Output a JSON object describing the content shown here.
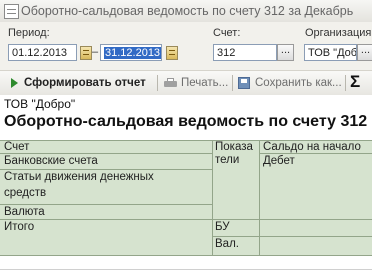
{
  "window": {
    "title": "Оборотно-сальдовая ведомость по счету 312 за Декабрь"
  },
  "params": {
    "period_label": "Период:",
    "date_from": "01.12.2013",
    "dash": "–",
    "date_to": "31.12.2013",
    "account_label": "Счет:",
    "account_value": "312",
    "dots": "...",
    "org_label": "Организация",
    "org_value": "ТОВ \"Добро\""
  },
  "toolbar": {
    "generate": "Сформировать отчет",
    "print": "Печать...",
    "save": "Сохранить как...",
    "sum": "Σ"
  },
  "report": {
    "organization": "ТОВ \"Добро\"",
    "title": "Оборотно-сальдовая ведомость по счету 312",
    "header": {
      "account": "Счет",
      "indicators_line1": "Показа",
      "indicators_line2": "тели",
      "opening_balance": "Сальдо на начало",
      "debit": "Дебет"
    },
    "rows": [
      "Банковские счета",
      "Статьи движения денежных",
      "средств",
      "Валюта"
    ],
    "total": {
      "label": "Итого",
      "bu": "БУ",
      "val": "Вал."
    }
  }
}
